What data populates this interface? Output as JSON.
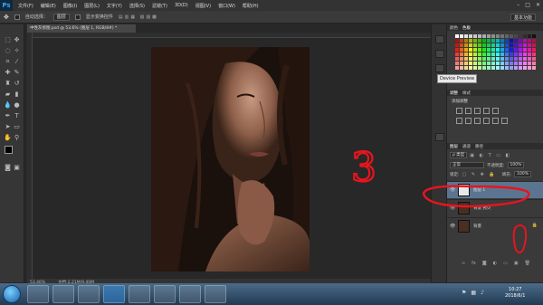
{
  "app": {
    "logo": "Ps",
    "menu": [
      "文件(F)",
      "编辑(E)",
      "图像(I)",
      "图层(L)",
      "文字(Y)",
      "选择(S)",
      "滤镜(T)",
      "3D(D)",
      "视图(V)",
      "窗口(W)",
      "帮助(H)"
    ],
    "window_controls": [
      "–",
      "□",
      "✕"
    ]
  },
  "options_bar": {
    "auto_select_label": "自动选择：",
    "auto_select_value": "图层",
    "show_transform_label": "显示变换控件",
    "workspace": "基本功能"
  },
  "document": {
    "tab_title": "中性灰修图.psd @ 53.6% (图层 1, RGB/8#) *",
    "zoom": "53.46%",
    "doc_info": "文档:2.21M/9.40M"
  },
  "tooltip": "Device Preview",
  "panels": {
    "swatch_tabs": [
      "颜色",
      "色板"
    ],
    "adjust_tabs": [
      "调整",
      "样式"
    ],
    "adjust_title": "添加调整",
    "layers_tabs": [
      "图层",
      "通道",
      "路径"
    ],
    "filter_kind": "ρ 类型",
    "blend_mode": "正常",
    "opacity_label": "不透明度:",
    "opacity_value": "100%",
    "lock_label": "锁定:",
    "fill_label": "填充:",
    "fill_value": "100%",
    "layers": [
      {
        "name": "图层 1",
        "selected": true
      },
      {
        "name": "背景 拷贝",
        "selected": false
      },
      {
        "name": "背景",
        "selected": false
      }
    ],
    "footer_icons": [
      "link-icon",
      "fx-icon",
      "mask-icon",
      "adjustment-icon",
      "group-icon",
      "new-layer-icon",
      "trash-icon"
    ]
  },
  "annotation": {
    "number": "3",
    "color": "#e8141e"
  },
  "taskbar": {
    "time": "10:27",
    "date": "2018/6/1"
  },
  "colors": {
    "menubar": "#333333",
    "panel": "#3a3a3a",
    "canvas": "#282828",
    "selected_layer": "#5b7590",
    "taskbar": "#2d4a66"
  }
}
